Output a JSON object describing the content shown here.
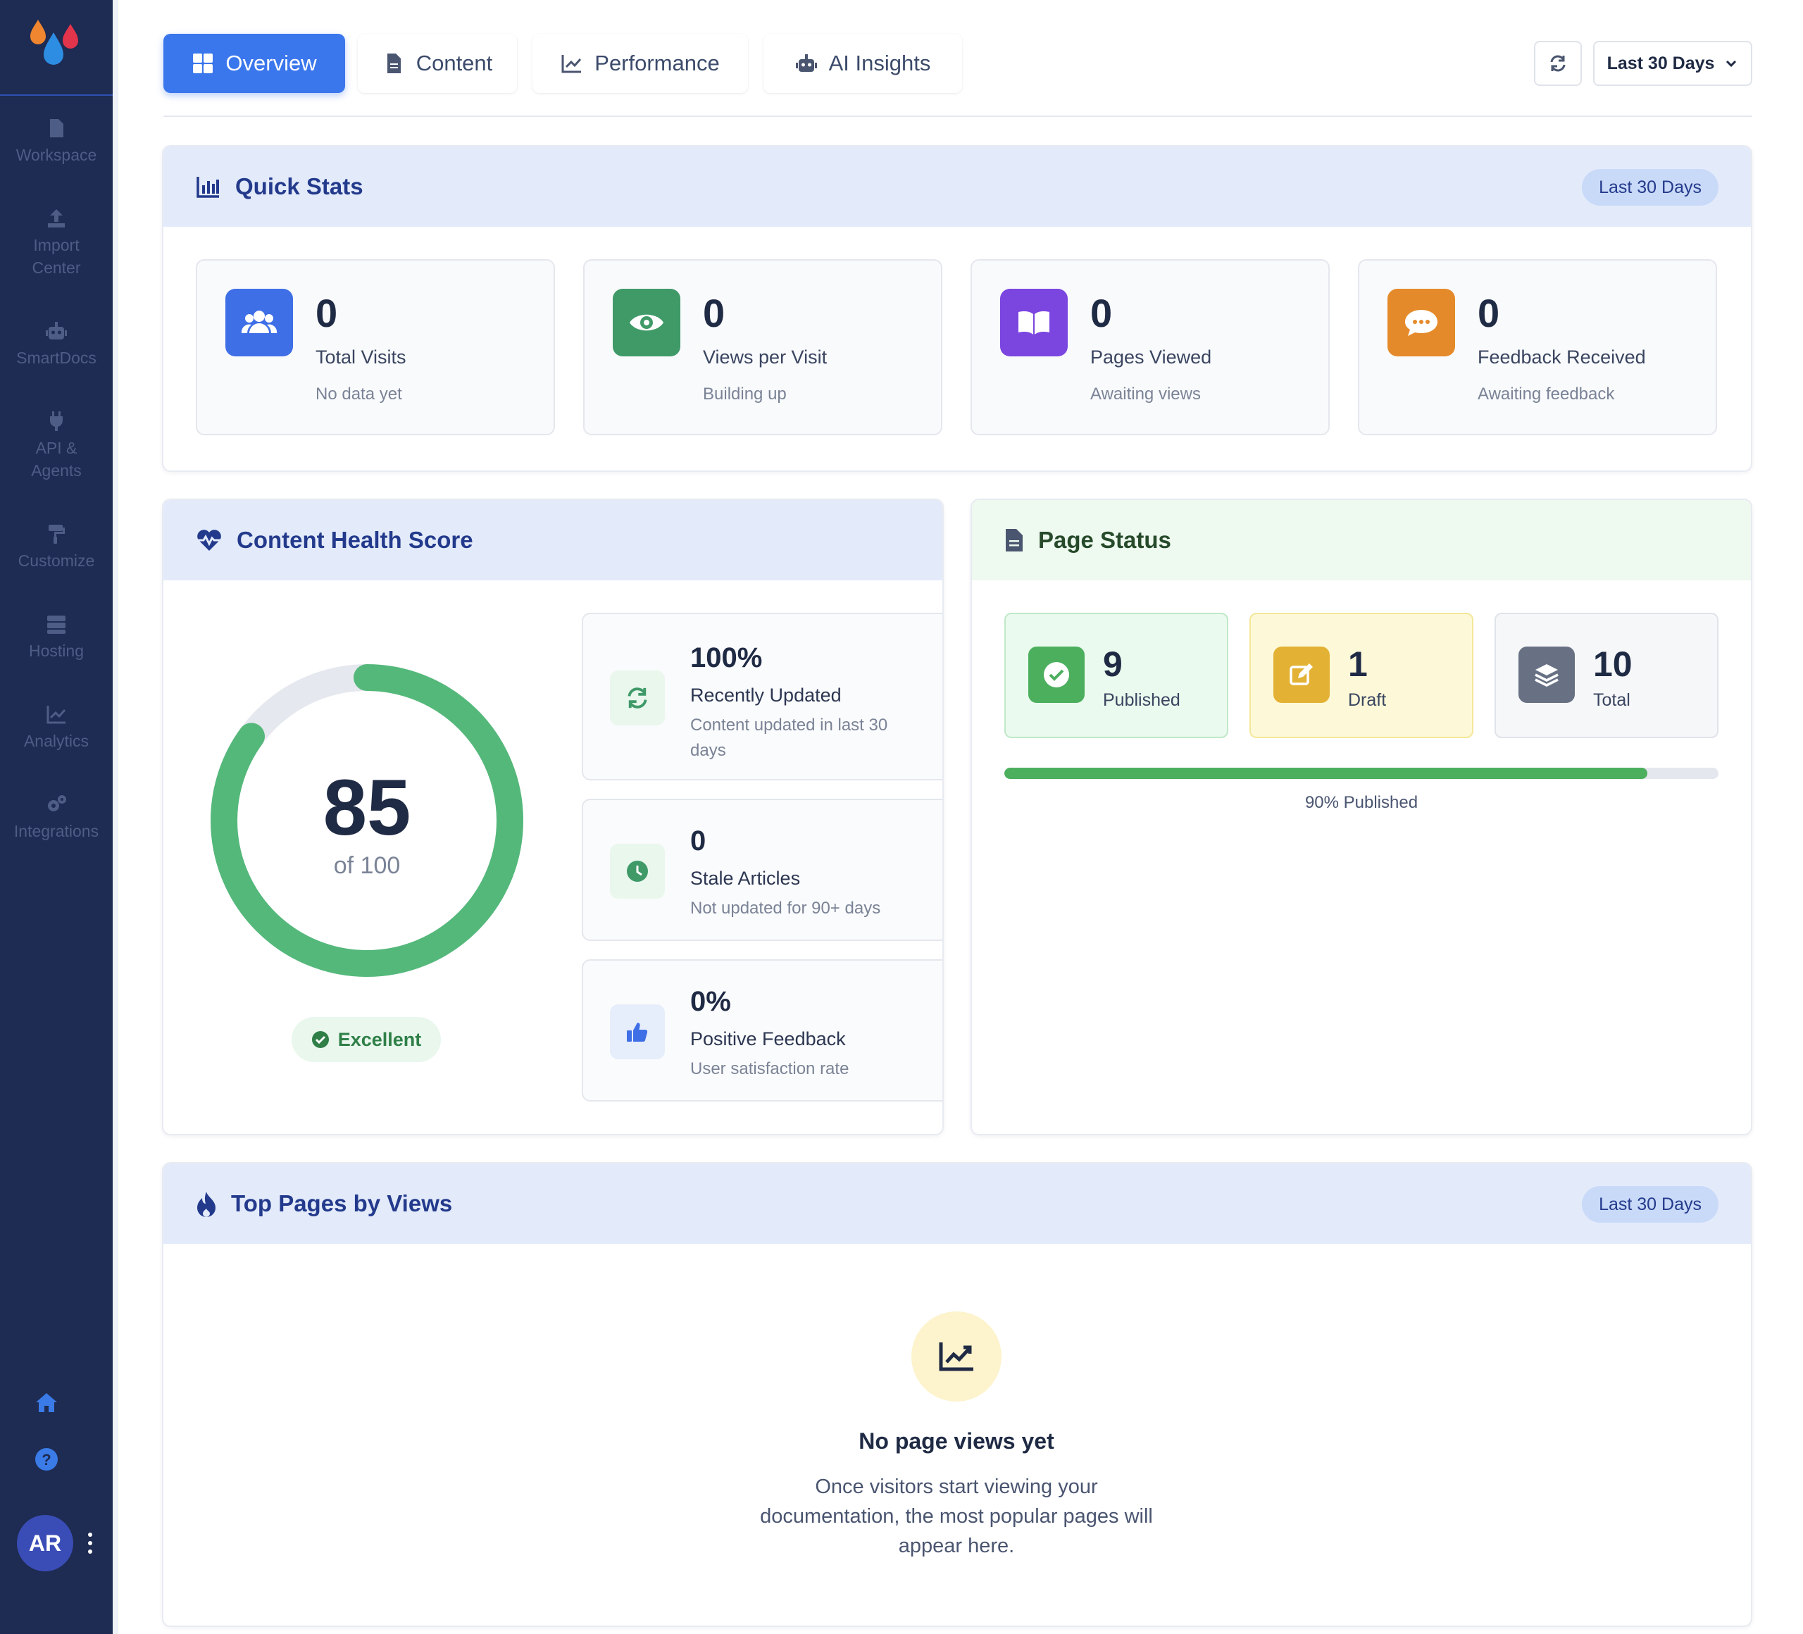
{
  "sidebar": {
    "items": [
      {
        "label": "Workspace",
        "icon": "document-icon"
      },
      {
        "label": "Import Center",
        "icon": "upload-icon"
      },
      {
        "label": "SmartDocs",
        "icon": "robot-icon"
      },
      {
        "label": "API & Agents",
        "icon": "plug-icon"
      },
      {
        "label": "Customize",
        "icon": "paint-roller-icon"
      },
      {
        "label": "Hosting",
        "icon": "server-icon"
      },
      {
        "label": "Analytics",
        "icon": "chart-line-icon"
      },
      {
        "label": "Integrations",
        "icon": "gears-icon"
      }
    ],
    "avatar": "AR"
  },
  "tabs": [
    {
      "label": "Overview",
      "active": true
    },
    {
      "label": "Content",
      "active": false
    },
    {
      "label": "Performance",
      "active": false
    },
    {
      "label": "AI Insights",
      "active": false
    }
  ],
  "toolbar": {
    "range_label": "Last 30 Days"
  },
  "quick_stats": {
    "title": "Quick Stats",
    "pill": "Last 30 Days",
    "cards": [
      {
        "value": "0",
        "label": "Total Visits",
        "sub": "No data yet",
        "color": "#3f6fe6",
        "icon": "users-icon"
      },
      {
        "value": "0",
        "label": "Views per Visit",
        "sub": "Building up",
        "color": "#3f9a68",
        "icon": "eye-icon"
      },
      {
        "value": "0",
        "label": "Pages Viewed",
        "sub": "Awaiting views",
        "color": "#7b45e0",
        "icon": "book-open-icon"
      },
      {
        "value": "0",
        "label": "Feedback Received",
        "sub": "Awaiting feedback",
        "color": "#e58a2a",
        "icon": "comment-icon"
      }
    ]
  },
  "health": {
    "title": "Content Health Score",
    "score": "85",
    "of": "of 100",
    "score_fraction": 0.85,
    "badge": "Excellent",
    "metrics": [
      {
        "value": "100%",
        "label": "Recently Updated",
        "sub": "Content updated in last 30 days",
        "icon": "refresh-icon"
      },
      {
        "value": "0",
        "label": "Stale Articles",
        "sub": "Not updated for 90+ days",
        "icon": "clock-icon"
      },
      {
        "value": "0%",
        "label": "Positive Feedback",
        "sub": "User satisfaction rate",
        "icon": "thumbs-up-icon"
      }
    ]
  },
  "page_status": {
    "title": "Page Status",
    "cards": [
      {
        "value": "9",
        "label": "Published",
        "icon": "check-circle-icon"
      },
      {
        "value": "1",
        "label": "Draft",
        "icon": "edit-icon"
      },
      {
        "value": "10",
        "label": "Total",
        "icon": "layers-icon"
      }
    ],
    "published_fraction": 0.9,
    "progress_label": "90% Published"
  },
  "top_pages": {
    "title": "Top Pages by Views",
    "pill": "Last 30 Days",
    "empty_title": "No page views yet",
    "empty_text": "Once visitors start viewing your documentation, the most popular pages will appear here."
  }
}
